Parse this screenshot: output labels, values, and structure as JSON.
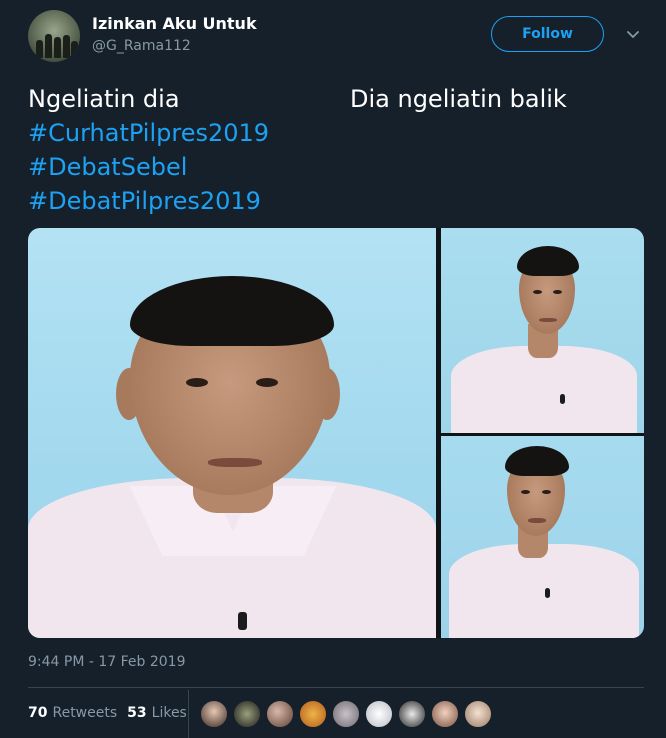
{
  "header": {
    "display_name": "Izinkan Aku Untuk",
    "handle": "@G_Rama112",
    "follow_label": "Follow",
    "menu_icon": "chevron-down-icon"
  },
  "tweet": {
    "line1_left": "Ngeliatin dia",
    "line1_right": "Dia ngeliatin balik",
    "hashtags": [
      "#CurhatPilpres2019",
      "#DebatSebel",
      "#DebatPilpres2019"
    ]
  },
  "media": {
    "image_count": 3
  },
  "footer": {
    "timestamp": "9:44 PM - 17 Feb 2019",
    "retweets_count": "70",
    "retweets_label": "Retweets",
    "likes_count": "53",
    "likes_label": "Likes",
    "liker_avatars": 9
  },
  "colors": {
    "background": "#15202b",
    "accent": "#1da1f2",
    "secondary_text": "#8899a6",
    "divider": "#38444d"
  }
}
